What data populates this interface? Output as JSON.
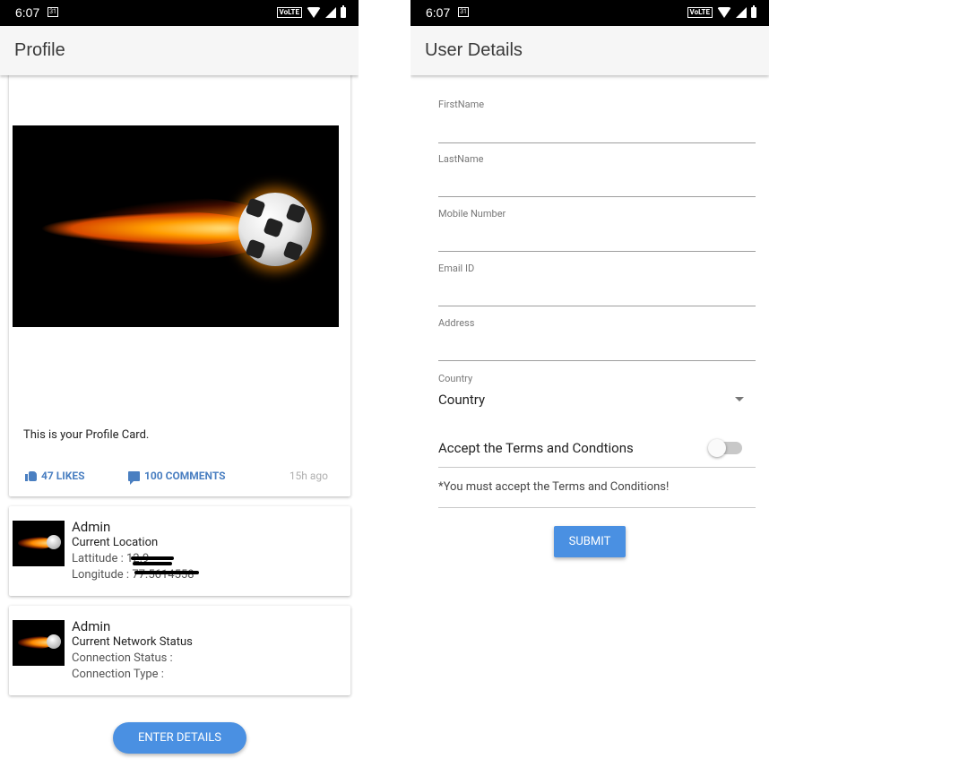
{
  "status": {
    "time": "6:07",
    "calendar_day": "31",
    "volte": "VoLTE"
  },
  "profile": {
    "title": "Profile",
    "card_text": "This is your Profile Card.",
    "likes": "47 LIKES",
    "comments": "100 COMMENTS",
    "ago": "15h ago",
    "location_card": {
      "name": "Admin",
      "heading": "Current Location",
      "lat_label": "Lattitude :",
      "lat_value": "12.9",
      "lon_label": "Longitude :",
      "lon_value": "77.5614558"
    },
    "network_card": {
      "name": "Admin",
      "heading": "Current Network Status",
      "status_label": "Connection Status :",
      "type_label": "Connection Type :"
    },
    "enter_btn": "ENTER DETAILS"
  },
  "details": {
    "title": "User Details",
    "fields": {
      "first": "FirstName",
      "last": "LastName",
      "mobile": "Mobile Number",
      "email": "Email ID",
      "address": "Address"
    },
    "country_label": "Country",
    "country_value": "Country",
    "terms": "Accept the Terms and Condtions",
    "terms_accepted": false,
    "warning": "*You must accept the Terms and Conditions!",
    "submit": "SUBMIT"
  }
}
